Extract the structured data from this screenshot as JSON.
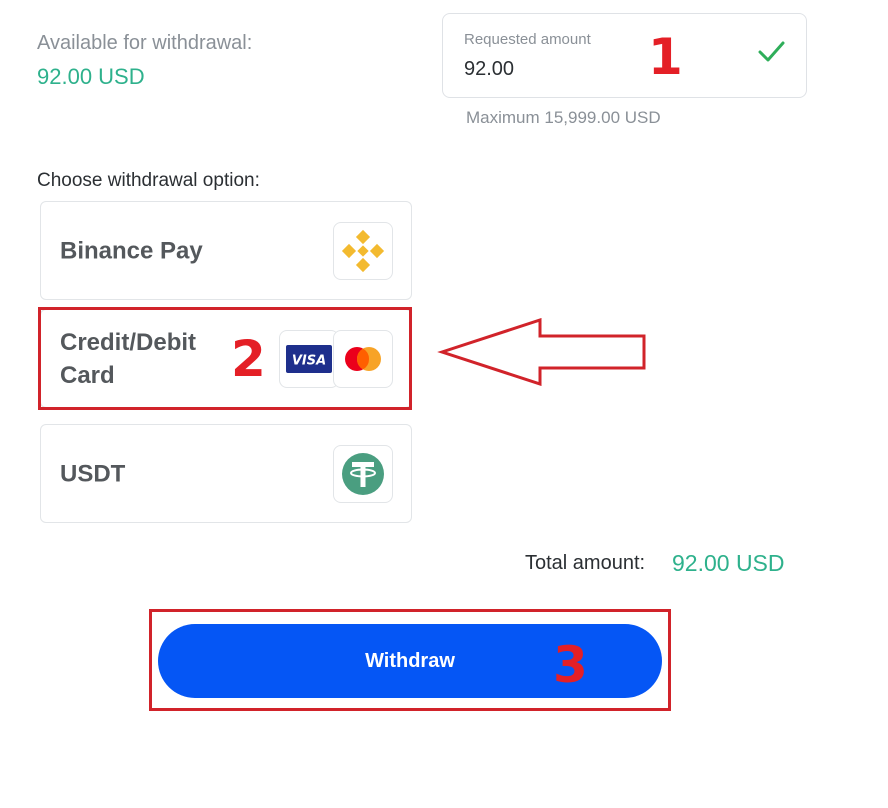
{
  "availability": {
    "label": "Available for withdrawal:",
    "value": "92.00 USD"
  },
  "amount": {
    "label": "Requested amount",
    "value": "92.00",
    "max_note": "Maximum 15,999.00 USD",
    "status_icon": "checkmark-icon"
  },
  "options": {
    "label": "Choose withdrawal option:",
    "items": [
      {
        "label": "Binance Pay",
        "icon": "binance-icon"
      },
      {
        "label": "Credit/Debit Card",
        "icons": [
          "visa-icon",
          "mastercard-icon"
        ],
        "visa_text": "VISA",
        "highlighted": true
      },
      {
        "label": "USDT",
        "icon": "tether-icon"
      }
    ]
  },
  "total": {
    "label": "Total amount:",
    "value": "92.00 USD"
  },
  "withdraw_button": {
    "label": "Withdraw"
  },
  "annotations": {
    "step1": "1",
    "step2": "2",
    "step3": "3"
  },
  "colors": {
    "accent_green": "#2eb18c",
    "button_blue": "#0556f5",
    "annotation_red": "#d1232a",
    "binance_yellow": "#f3ba2f",
    "tether_green": "#4a9e80"
  }
}
